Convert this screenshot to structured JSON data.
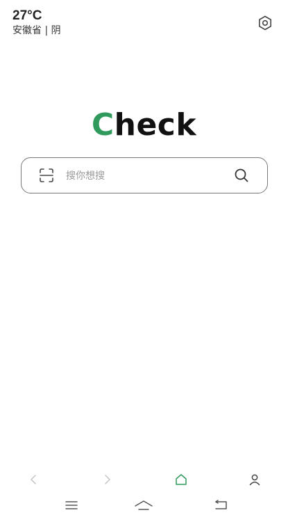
{
  "weather": {
    "temperature": "27°C",
    "location": "安徽省 | 阴"
  },
  "logo": {
    "first_letter": "C",
    "rest": "heck",
    "accent_color": "#2f9a5c"
  },
  "search": {
    "placeholder": "搜你想搜",
    "left_icon": "scan-icon",
    "right_icon": "search-icon"
  },
  "browser_nav": {
    "items": [
      "back-icon",
      "forward-icon",
      "home-icon",
      "profile-icon"
    ],
    "active": "home-icon"
  },
  "system_nav": {
    "items": [
      "menu-icon",
      "home-icon",
      "back-icon"
    ]
  },
  "top_right": {
    "icon": "gear-icon"
  }
}
